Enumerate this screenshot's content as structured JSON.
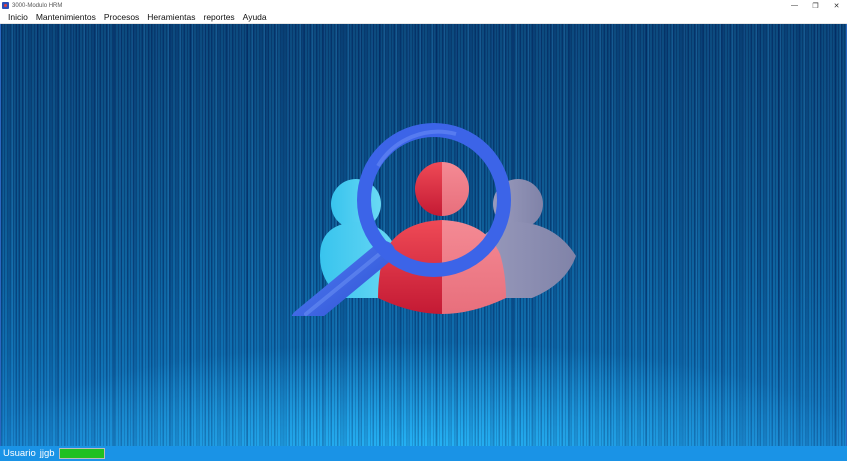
{
  "window": {
    "title": "3000-Modulo HRM",
    "icon": "app-icon",
    "controls": {
      "minimize": "—",
      "restore": "❐",
      "close": "✕"
    }
  },
  "menu": {
    "items": [
      {
        "label": "Inicio"
      },
      {
        "label": "Mantenimientos"
      },
      {
        "label": "Procesos"
      },
      {
        "label": "Heramientas"
      },
      {
        "label": "reportes"
      },
      {
        "label": "Ayuda"
      }
    ]
  },
  "main": {
    "logo_icon": "people-search-icon",
    "colors": {
      "background_top": "#0c4a7e",
      "background_bottom": "#1883cc",
      "person_left": "#4fd0f2",
      "person_center": "#e03a4c",
      "person_right": "#8e8fb3",
      "magnifier": "#3c64e8"
    }
  },
  "status": {
    "user_label": "Usuario",
    "user_value": "jjgb",
    "progress": 1.0,
    "bar_color": "#1a93e6",
    "progress_color": "#20c020"
  }
}
